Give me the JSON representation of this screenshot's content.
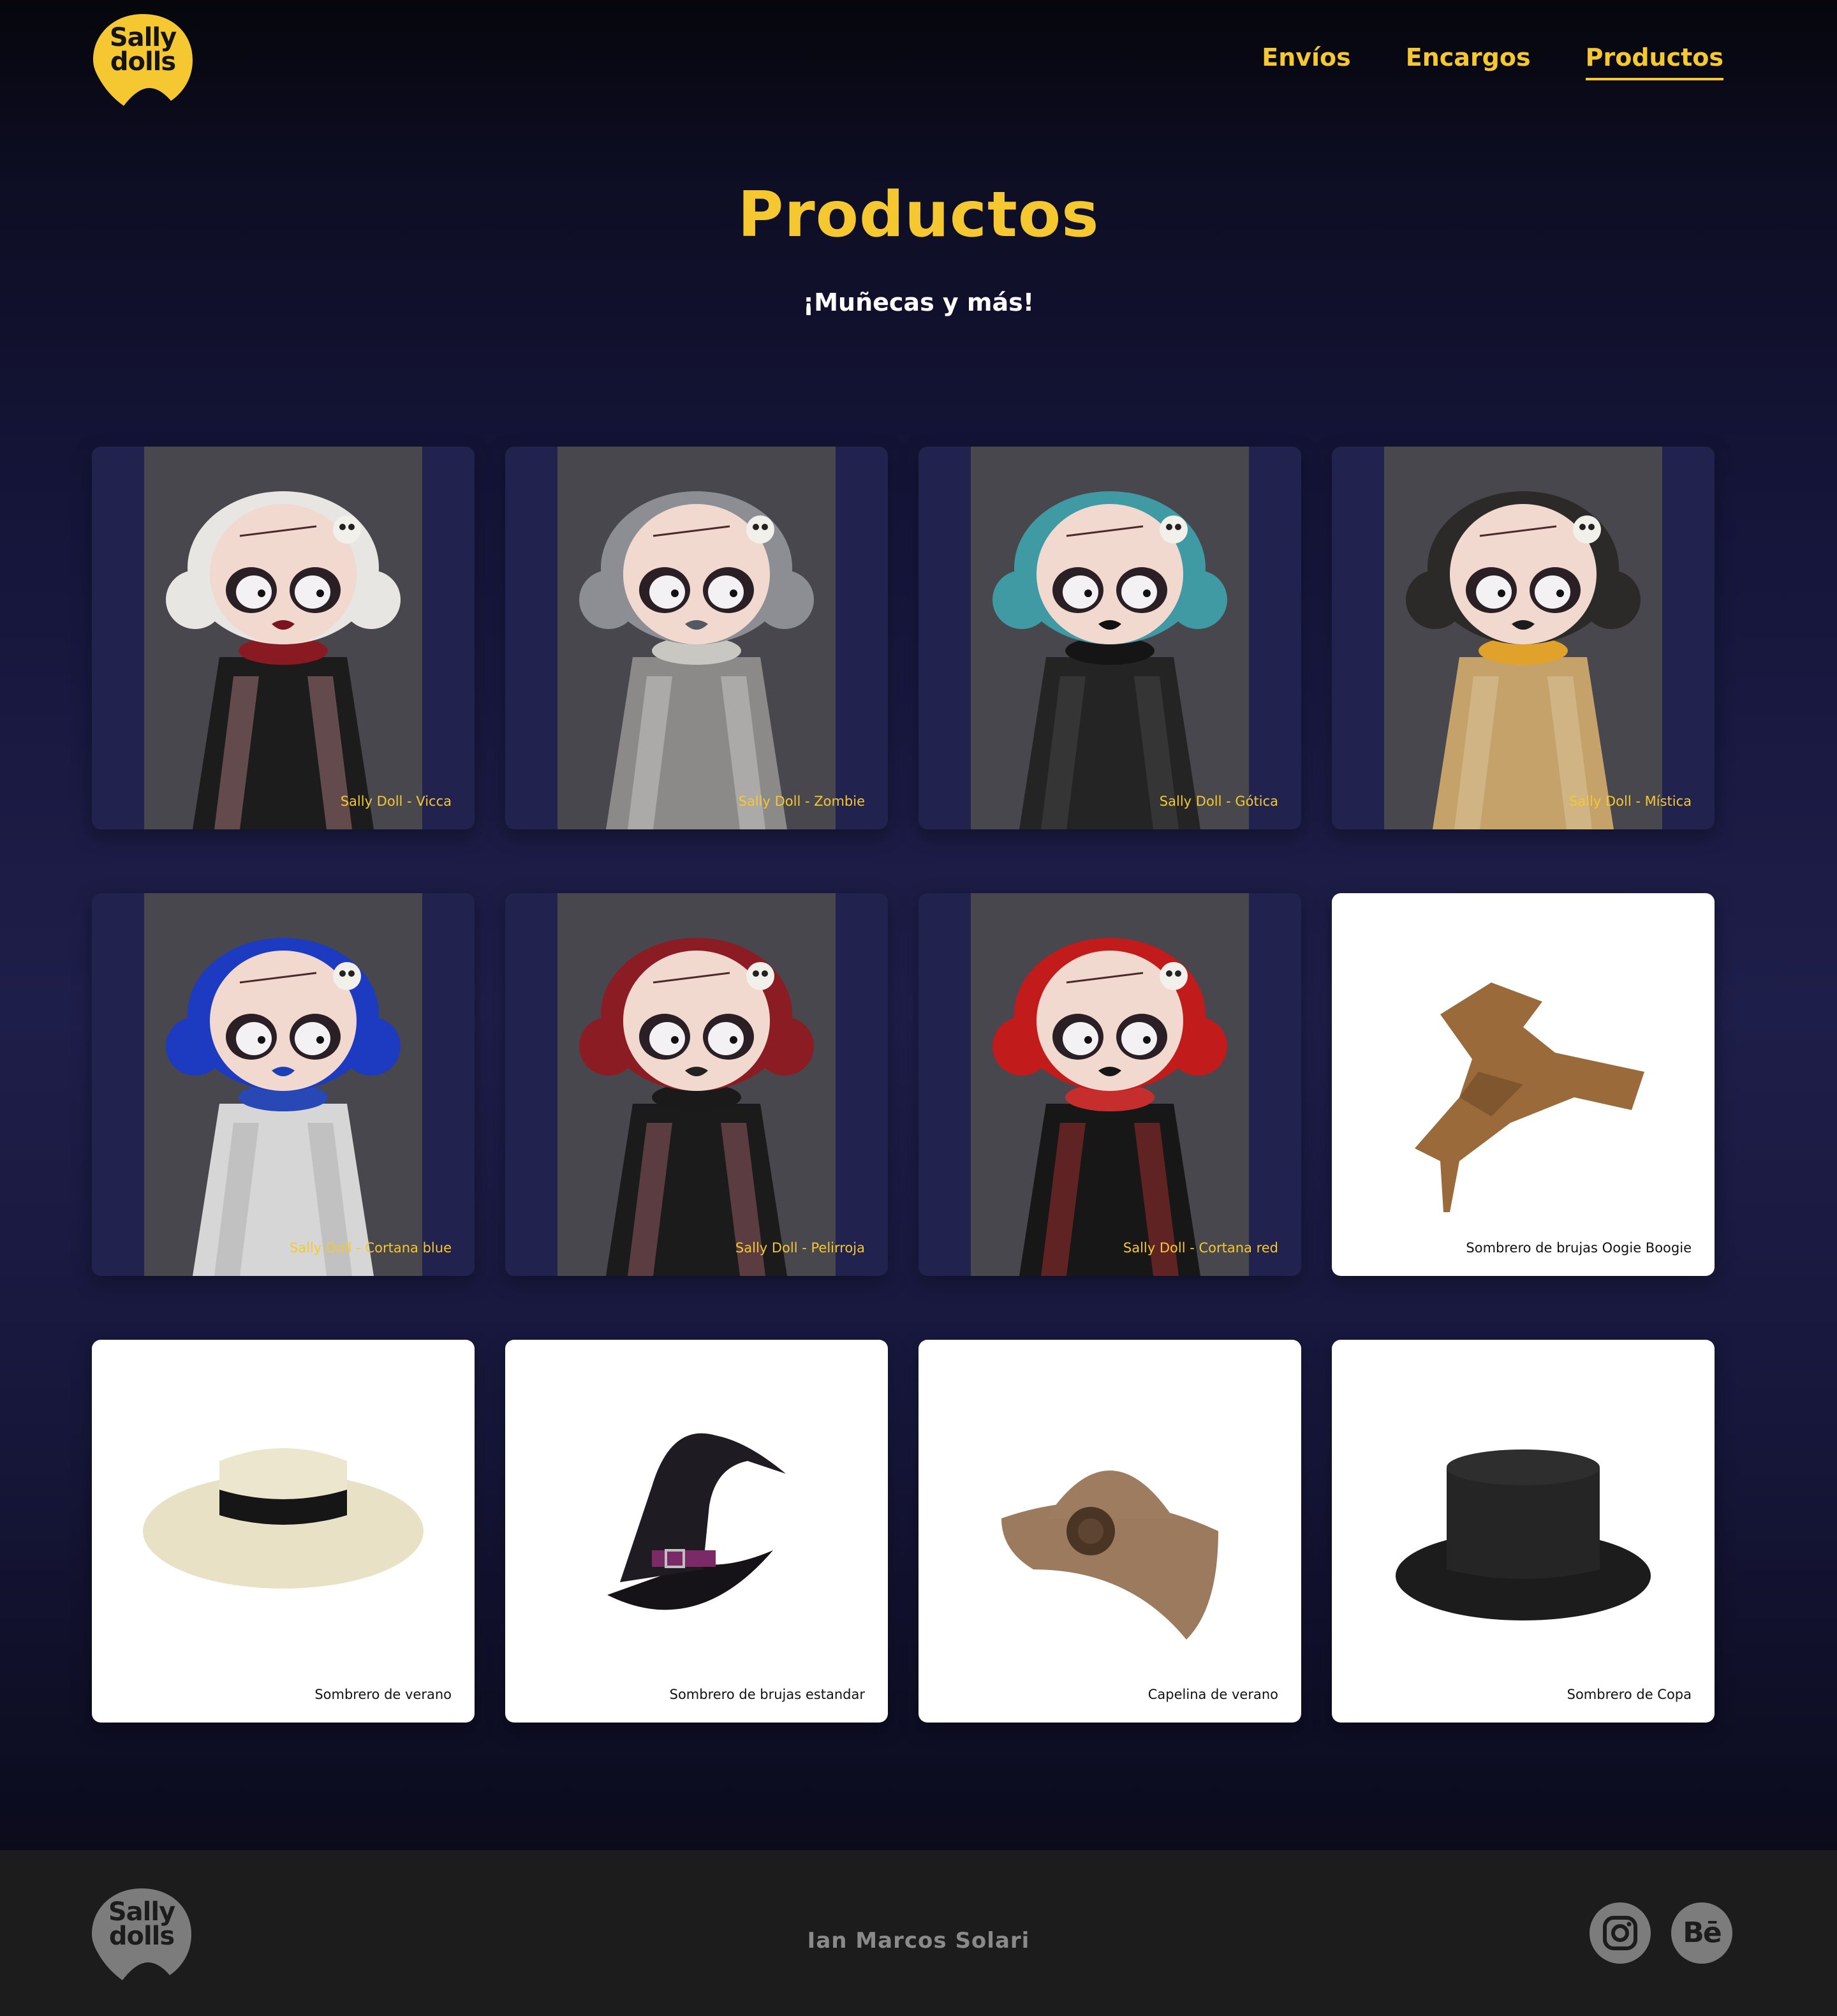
{
  "header": {
    "logo_line1": "Sally",
    "logo_line2": "dolls",
    "nav": [
      {
        "label": "Envíos",
        "active": false
      },
      {
        "label": "Encargos",
        "active": false
      },
      {
        "label": "Productos",
        "active": true
      }
    ]
  },
  "hero": {
    "title": "Productos",
    "subtitle": "¡Muñecas y más!"
  },
  "products": [
    {
      "name": "Sally Doll - Vicca",
      "kind": "doll",
      "hair": "#e8e6e2",
      "lips": "#7a1420",
      "collar": "#8a1a22",
      "dress": "#1c1c1c",
      "accent": "#e8a0a8"
    },
    {
      "name": "Sally Doll - Zombie",
      "kind": "doll",
      "hair": "#8c8e94",
      "lips": "#545860",
      "collar": "#c9c7c2",
      "dress": "#8c8a88",
      "accent": "#e6e6e6"
    },
    {
      "name": "Sally Doll - Gótica",
      "kind": "doll",
      "hair": "#3f9aa3",
      "lips": "#111111",
      "collar": "#151515",
      "dress": "#242424",
      "accent": "#555555"
    },
    {
      "name": "Sally Doll -  Mística",
      "kind": "doll",
      "hair": "#2c2a28",
      "lips": "#1c1c1c",
      "collar": "#e0a22a",
      "dress": "#c4a26a",
      "accent": "#e9d8b4"
    },
    {
      "name": "Sally Doll - Cortana blue",
      "kind": "doll",
      "hair": "#1d3bc0",
      "lips": "#1b3fb6",
      "collar": "#2848b6",
      "dress": "#d6d6d6",
      "accent": "#9a9a9a"
    },
    {
      "name": "Sally Doll - Pelirroja",
      "kind": "doll",
      "hair": "#8c1c24",
      "lips": "#222222",
      "collar": "#1a1a1a",
      "dress": "#1b1b1b",
      "accent": "#d07a8a"
    },
    {
      "name": "Sally Doll - Cortana red",
      "kind": "doll",
      "hair": "#c11b1b",
      "lips": "#161616",
      "collar": "#c62e2e",
      "dress": "#171717",
      "accent": "#e8393a"
    },
    {
      "name": "Sombrero de brujas Oogie Boogie",
      "kind": "hat",
      "hat": "oogie"
    },
    {
      "name": "Sombrero de verano",
      "kind": "hat",
      "hat": "summer"
    },
    {
      "name": "Sombrero de brujas estandar",
      "kind": "hat",
      "hat": "witch"
    },
    {
      "name": "Capelina de verano",
      "kind": "hat",
      "hat": "cloche"
    },
    {
      "name": "Sombrero de Copa",
      "kind": "hat",
      "hat": "tophat"
    }
  ],
  "footer": {
    "logo_line1": "Sally",
    "logo_line2": "dolls",
    "author": "Ian Marcos Solari",
    "social": [
      {
        "name": "instagram-icon"
      },
      {
        "name": "behance-icon",
        "text": "Bē"
      }
    ]
  },
  "colors": {
    "accent": "#f5c832",
    "card_dark": "#22224e",
    "footer_bg": "#1c1c1c",
    "footer_text": "#8a8a8a"
  }
}
